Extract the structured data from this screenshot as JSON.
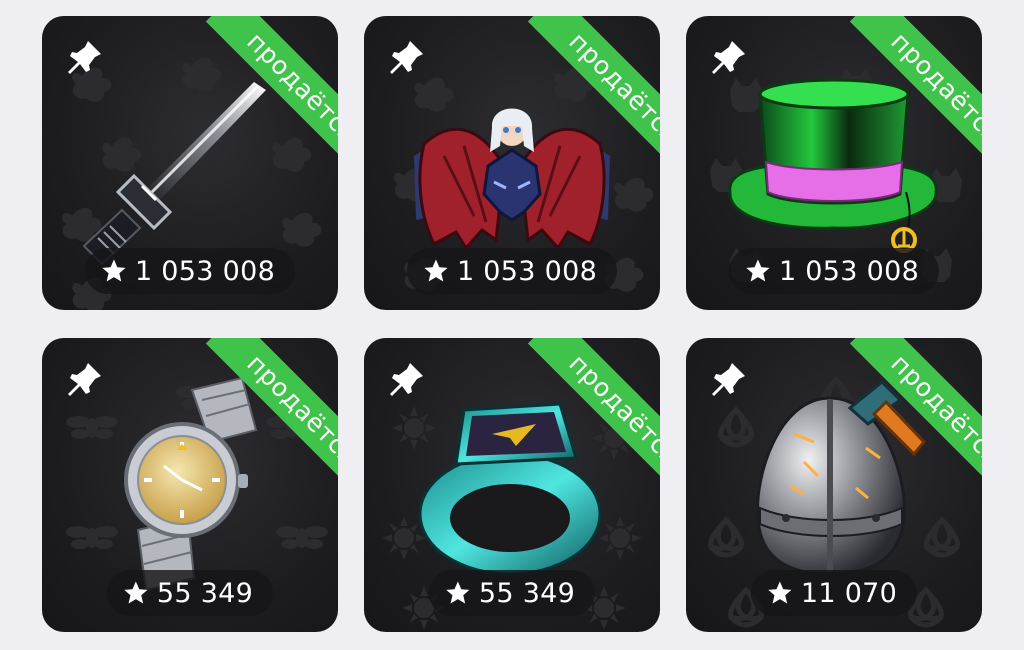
{
  "status_label": "продаётся",
  "colors": {
    "page_bg": "#eeeef3",
    "card_bg": "#1d1d20",
    "ribbon": "#3fc34b",
    "text": "#ffffff"
  },
  "gifts": [
    {
      "item": "sword-icon",
      "price": "1 053 008"
    },
    {
      "item": "dragon-icon",
      "price": "1 053 008"
    },
    {
      "item": "top-hat-icon",
      "price": "1 053 008"
    },
    {
      "item": "watch-icon",
      "price": "55 349"
    },
    {
      "item": "ring-icon",
      "price": "55 349"
    },
    {
      "item": "armored-egg-icon",
      "price": "11 070"
    }
  ]
}
